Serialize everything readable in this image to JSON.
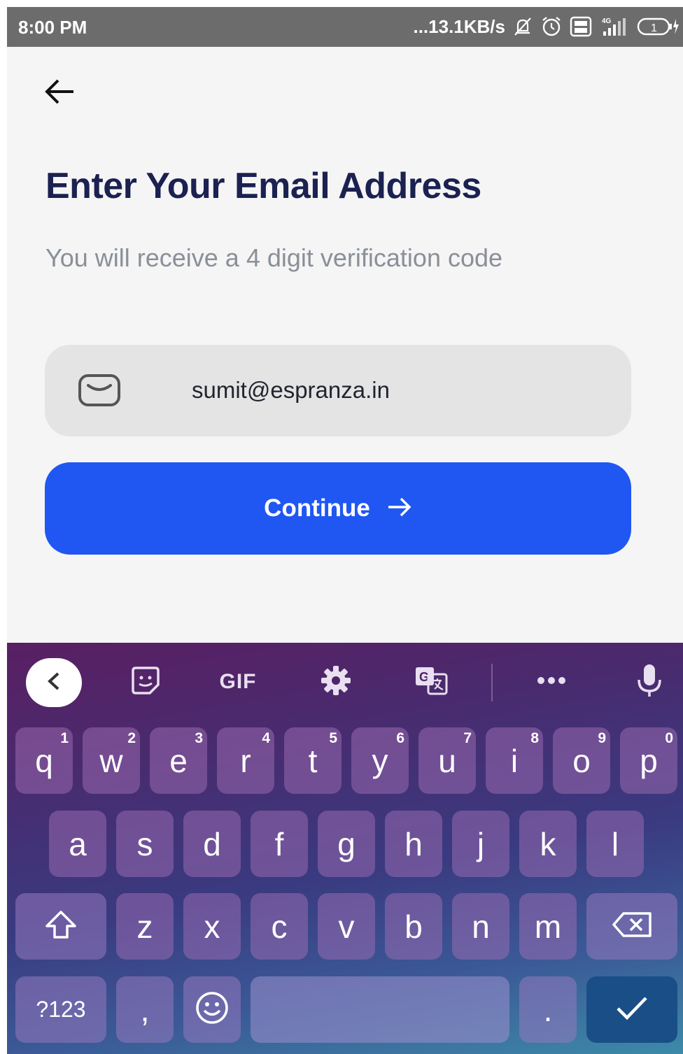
{
  "status_bar": {
    "time": "8:00 PM",
    "network_speed": "...13.1KB/s",
    "icons": [
      "notifications-off-icon",
      "alarm-icon",
      "volte-icon",
      "signal-4g-icon",
      "battery-icon"
    ],
    "battery_level": "1"
  },
  "header": {
    "back_icon": "arrow-left-icon",
    "title": "Enter Your Email Address",
    "subtitle": "You will receive a 4 digit verification code"
  },
  "email_field": {
    "icon": "mail-icon",
    "value": "sumit@espranza.in"
  },
  "continue_button": {
    "label": "Continue",
    "icon": "arrow-right-icon"
  },
  "keyboard": {
    "toolbar": {
      "collapse_icon": "chevron-left-icon",
      "sticker_icon": "sticker-icon",
      "gif_label": "GIF",
      "settings_icon": "gear-icon",
      "translate_icon": "translate-icon",
      "more_icon": "more-horizontal-icon",
      "mic_icon": "microphone-icon"
    },
    "row1": [
      {
        "key": "q",
        "hint": "1"
      },
      {
        "key": "w",
        "hint": "2"
      },
      {
        "key": "e",
        "hint": "3"
      },
      {
        "key": "r",
        "hint": "4"
      },
      {
        "key": "t",
        "hint": "5"
      },
      {
        "key": "y",
        "hint": "6"
      },
      {
        "key": "u",
        "hint": "7"
      },
      {
        "key": "i",
        "hint": "8"
      },
      {
        "key": "o",
        "hint": "9"
      },
      {
        "key": "p",
        "hint": "0"
      }
    ],
    "row2": [
      "a",
      "s",
      "d",
      "f",
      "g",
      "h",
      "j",
      "k",
      "l"
    ],
    "row3": [
      "z",
      "x",
      "c",
      "v",
      "b",
      "n",
      "m"
    ],
    "symbols_label": "?123",
    "comma": ",",
    "period": ".",
    "accent_color": "#2057f3",
    "enter_color": "#1a4e86"
  },
  "colors": {
    "title": "#1b2150",
    "subtitle": "#8a8f98",
    "field_bg": "#e4e4e4",
    "button": "#2057f3"
  }
}
